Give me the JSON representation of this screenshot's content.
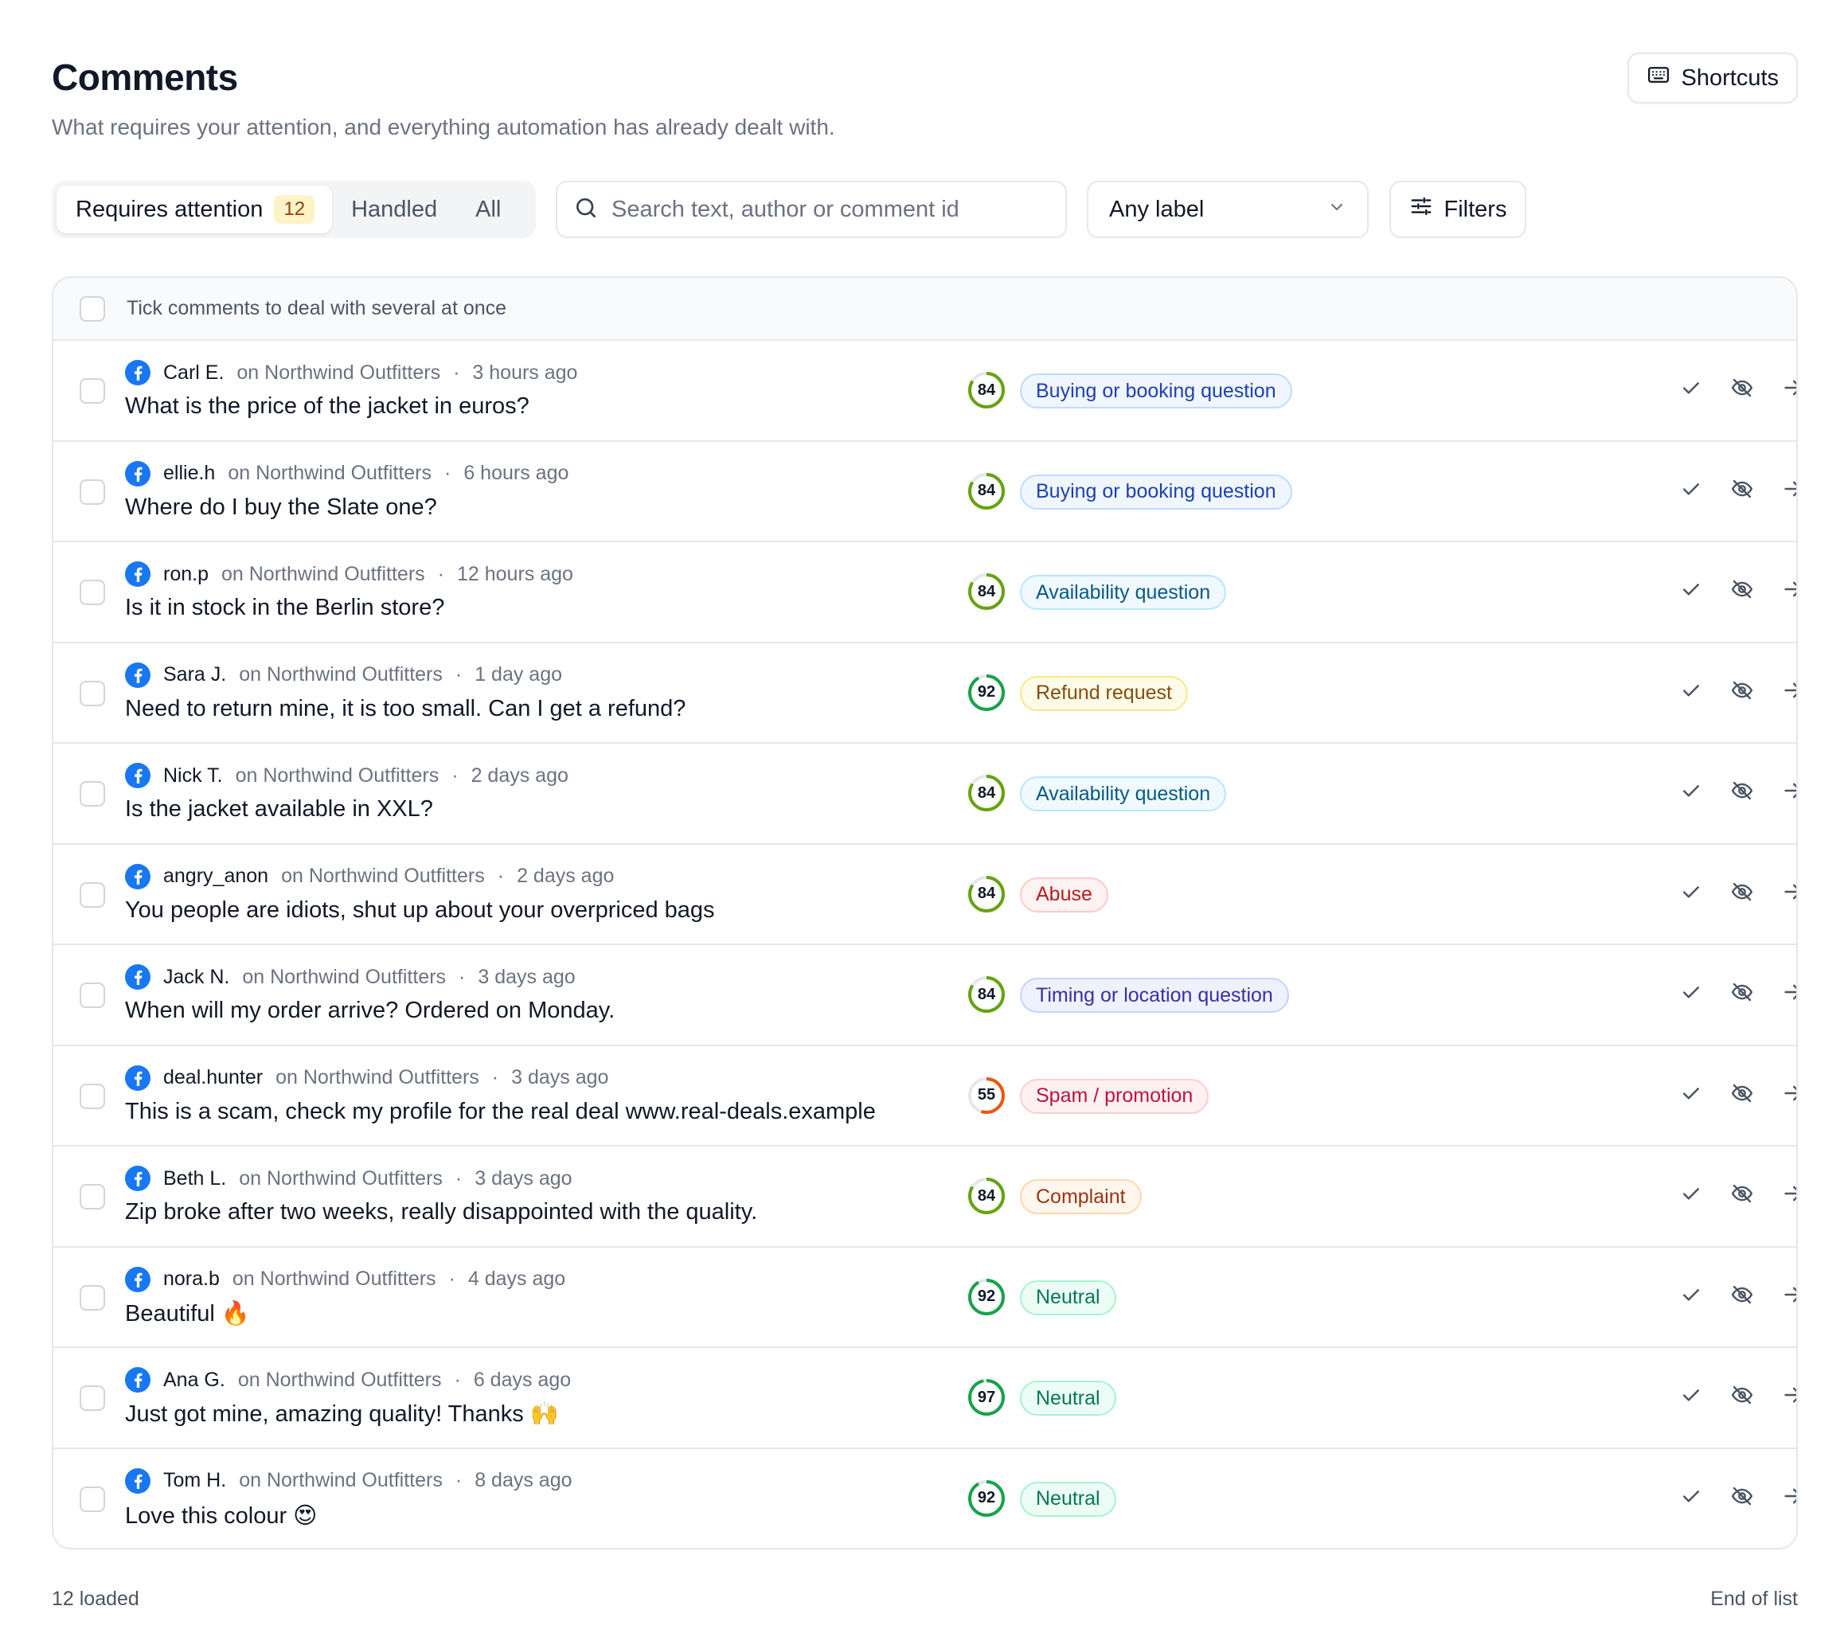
{
  "header": {
    "title": "Comments",
    "subtitle": "What requires your attention, and everything automation has already dealt with.",
    "shortcuts_label": "Shortcuts"
  },
  "tabs": [
    {
      "label": "Requires attention",
      "count": "12",
      "active": true
    },
    {
      "label": "Handled"
    },
    {
      "label": "All"
    }
  ],
  "search": {
    "placeholder": "Search text, author or comment id",
    "value": ""
  },
  "label_filter": {
    "selected": "Any label"
  },
  "filters_label": "Filters",
  "list_header": "Tick comments to deal with several at once",
  "comments": [
    {
      "author": "Carl E.",
      "page": "on Northwind Outfitters",
      "time": "3 hours ago",
      "text": "What is the price of the jacket in euros?",
      "score": 84,
      "label": "Buying or booking question",
      "label_kind": "buying"
    },
    {
      "author": "ellie.h",
      "page": "on Northwind Outfitters",
      "time": "6 hours ago",
      "text": "Where do I buy the Slate one?",
      "score": 84,
      "label": "Buying or booking question",
      "label_kind": "buying"
    },
    {
      "author": "ron.p",
      "page": "on Northwind Outfitters",
      "time": "12 hours ago",
      "text": "Is it in stock in the Berlin store?",
      "score": 84,
      "label": "Availability question",
      "label_kind": "availability"
    },
    {
      "author": "Sara J.",
      "page": "on Northwind Outfitters",
      "time": "1 day ago",
      "text": "Need to return mine, it is too small. Can I get a refund?",
      "score": 92,
      "label": "Refund request",
      "label_kind": "refund"
    },
    {
      "author": "Nick T.",
      "page": "on Northwind Outfitters",
      "time": "2 days ago",
      "text": "Is the jacket available in XXL?",
      "score": 84,
      "label": "Availability question",
      "label_kind": "availability"
    },
    {
      "author": "angry_anon",
      "page": "on Northwind Outfitters",
      "time": "2 days ago",
      "text": "You people are idiots, shut up about your overpriced bags",
      "score": 84,
      "label": "Abuse",
      "label_kind": "abuse"
    },
    {
      "author": "Jack N.",
      "page": "on Northwind Outfitters",
      "time": "3 days ago",
      "text": "When will my order arrive? Ordered on Monday.",
      "score": 84,
      "label": "Timing or location question",
      "label_kind": "timing"
    },
    {
      "author": "deal.hunter",
      "page": "on Northwind Outfitters",
      "time": "3 days ago",
      "text": "This is a scam, check my profile for the real deal www.real-deals.example",
      "score": 55,
      "label": "Spam / promotion",
      "label_kind": "spam"
    },
    {
      "author": "Beth L.",
      "page": "on Northwind Outfitters",
      "time": "3 days ago",
      "text": "Zip broke after two weeks, really disappointed with the quality.",
      "score": 84,
      "label": "Complaint",
      "label_kind": "complaint"
    },
    {
      "author": "nora.b",
      "page": "on Northwind Outfitters",
      "time": "4 days ago",
      "text": "Beautiful 🔥",
      "score": 92,
      "label": "Neutral",
      "label_kind": "neutral"
    },
    {
      "author": "Ana G.",
      "page": "on Northwind Outfitters",
      "time": "6 days ago",
      "text": "Just got mine, amazing quality! Thanks 🙌",
      "score": 97,
      "label": "Neutral",
      "label_kind": "neutral"
    },
    {
      "author": "Tom H.",
      "page": "on Northwind Outfitters",
      "time": "8 days ago",
      "text": "Love this colour 😍",
      "score": 92,
      "label": "Neutral",
      "label_kind": "neutral"
    }
  ],
  "footer": {
    "loaded": "12 loaded",
    "end": "End of list"
  },
  "colors": {
    "facebook": "#1877f2",
    "score_high": "#16a34a",
    "score_mid": "#65a30d",
    "score_low": "#ea580c",
    "label_styles": {
      "buying": {
        "bg": "#eff6ff",
        "border": "#bfdbfe",
        "fg": "#1e40af"
      },
      "availability": {
        "bg": "#f0f9ff",
        "border": "#bae6fd",
        "fg": "#075985"
      },
      "refund": {
        "bg": "#fefce8",
        "border": "#fde68a",
        "fg": "#854d0e"
      },
      "abuse": {
        "bg": "#fef2f2",
        "border": "#fecaca",
        "fg": "#b91c1c"
      },
      "timing": {
        "bg": "#eef2ff",
        "border": "#c7d2fe",
        "fg": "#3730a3"
      },
      "spam": {
        "bg": "#fff1f2",
        "border": "#fecdd3",
        "fg": "#be123c"
      },
      "complaint": {
        "bg": "#fff7ed",
        "border": "#fed7aa",
        "fg": "#9a3412"
      },
      "neutral": {
        "bg": "#ecfdf5",
        "border": "#a7f3d0",
        "fg": "#047857"
      }
    }
  },
  "icons": {
    "shortcuts": "keyboard-icon",
    "search": "search-icon",
    "label_filter": "chevron-down-icon",
    "filters": "sliders-icon",
    "author_network": "facebook-icon",
    "actions": [
      "check-icon",
      "eye-off-icon",
      "arrow-right-icon"
    ]
  }
}
